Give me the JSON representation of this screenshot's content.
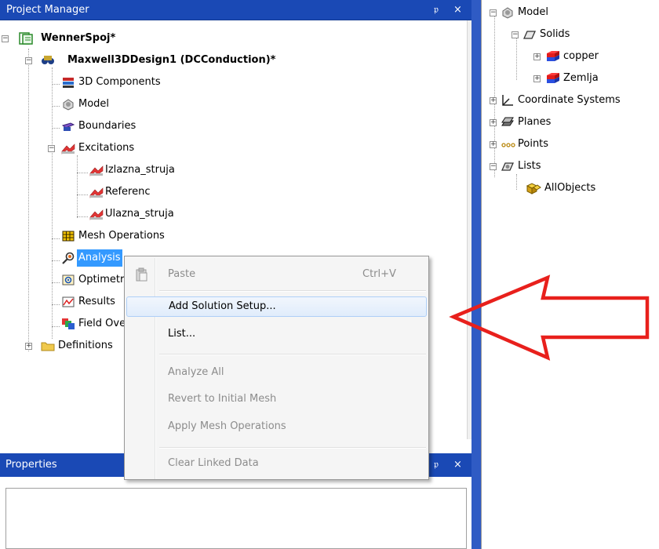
{
  "project_manager": {
    "title": "Project Manager",
    "pin": "ᵖ",
    "close": "×",
    "tree": {
      "root": "WennerSpoj*",
      "design": "Maxwell3DDesign1 (DCConduction)*",
      "items": {
        "components": "3D Components",
        "model": "Model",
        "boundaries": "Boundaries",
        "excitations": "Excitations",
        "izlazna": "Izlazna_struja",
        "referenc": "Referenc",
        "ulazna": "Ulazna_struja",
        "mesh_ops": "Mesh Operations",
        "analysis": "Analysis",
        "optimetrics": "Optimetrics",
        "results": "Results",
        "field": "Field Overlays",
        "definitions": "Definitions"
      }
    }
  },
  "properties": {
    "title": "Properties",
    "pin": "ᵖ",
    "close": "×"
  },
  "model_tree": {
    "model": "Model",
    "solids": "Solids",
    "copper": "copper",
    "zemlja": "Zemlja",
    "coord": "Coordinate Systems",
    "planes": "Planes",
    "points": "Points",
    "lists": "Lists",
    "allobjects": "AllObjects"
  },
  "context_menu": {
    "paste": "Paste",
    "paste_shortcut": "Ctrl+V",
    "add_solution": "Add Solution Setup...",
    "list": "List...",
    "analyze_all": "Analyze All",
    "revert": "Revert to Initial Mesh",
    "apply_mesh": "Apply Mesh Operations",
    "clear_linked": "Clear Linked Data"
  },
  "colors": {
    "title_bar": "#1a49b5",
    "selection": "#3399ff",
    "arrow": "#e8201c"
  },
  "icons": [
    "project-icon",
    "design-icon",
    "components-icon",
    "model-icon",
    "boundaries-icon",
    "excitation-icon",
    "mesh-icon",
    "analysis-icon",
    "optimetrics-icon",
    "results-icon",
    "field-icon",
    "folder-icon",
    "paste-icon",
    "solids-icon",
    "solid-box-icon",
    "coordinate-icon",
    "planes-icon",
    "points-icon",
    "lists-icon",
    "allobjects-icon"
  ]
}
